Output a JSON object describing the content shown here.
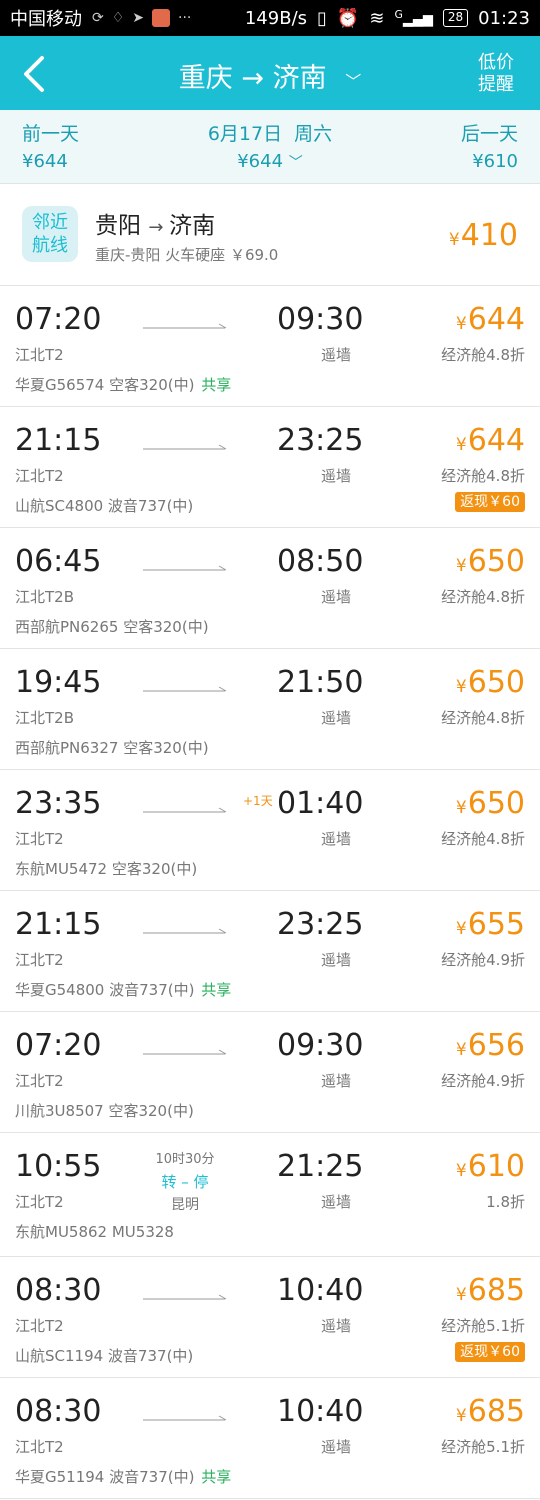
{
  "status_bar": {
    "carrier": "中国移动",
    "speed": "149B/s",
    "network": "G",
    "battery": "28",
    "time": "01:23"
  },
  "header": {
    "from": "重庆",
    "to": "济南",
    "alert_label_line1": "低价",
    "alert_label_line2": "提醒"
  },
  "date_bar": {
    "prev_label": "前一天",
    "prev_price": "¥644",
    "current_date": "6月17日",
    "current_weekday": "周六",
    "current_price": "¥644",
    "next_label": "后一天",
    "next_price": "¥610"
  },
  "nearby": {
    "badge_line1": "邻近",
    "badge_line2": "航线",
    "from": "贵阳",
    "to": "济南",
    "subtitle": "重庆-贵阳 火车硬座 ￥69.0",
    "price": "410",
    "currency": "¥"
  },
  "flights": [
    {
      "dep_time": "07:20",
      "arr_time": "09:30",
      "dep_term": "江北T2",
      "arr_term": "遥墙",
      "airline": "华夏G56574 空客320(中)",
      "tag": "共享",
      "price": "644",
      "cabin": "经济舱4.8折",
      "cashback": "",
      "plus_day": ""
    },
    {
      "dep_time": "21:15",
      "arr_time": "23:25",
      "dep_term": "江北T2",
      "arr_term": "遥墙",
      "airline": "山航SC4800 波音737(中)",
      "tag": "",
      "price": "644",
      "cabin": "经济舱4.8折",
      "cashback": "返现￥60",
      "plus_day": ""
    },
    {
      "dep_time": "06:45",
      "arr_time": "08:50",
      "dep_term": "江北T2B",
      "arr_term": "遥墙",
      "airline": "西部航PN6265 空客320(中)",
      "tag": "",
      "price": "650",
      "cabin": "经济舱4.8折",
      "cashback": "",
      "plus_day": ""
    },
    {
      "dep_time": "19:45",
      "arr_time": "21:50",
      "dep_term": "江北T2B",
      "arr_term": "遥墙",
      "airline": "西部航PN6327 空客320(中)",
      "tag": "",
      "price": "650",
      "cabin": "经济舱4.8折",
      "cashback": "",
      "plus_day": ""
    },
    {
      "dep_time": "23:35",
      "arr_time": "01:40",
      "dep_term": "江北T2",
      "arr_term": "遥墙",
      "airline": "东航MU5472 空客320(中)",
      "tag": "",
      "price": "650",
      "cabin": "经济舱4.8折",
      "cashback": "",
      "plus_day": "+1天"
    },
    {
      "dep_time": "21:15",
      "arr_time": "23:25",
      "dep_term": "江北T2",
      "arr_term": "遥墙",
      "airline": "华夏G54800 波音737(中)",
      "tag": "共享",
      "price": "655",
      "cabin": "经济舱4.9折",
      "cashback": "",
      "plus_day": ""
    },
    {
      "dep_time": "07:20",
      "arr_time": "09:30",
      "dep_term": "江北T2",
      "arr_term": "遥墙",
      "airline": "川航3U8507 空客320(中)",
      "tag": "",
      "price": "656",
      "cabin": "经济舱4.9折",
      "cashback": "",
      "plus_day": ""
    },
    {
      "dep_time": "10:55",
      "arr_time": "21:25",
      "dep_term": "江北T2",
      "arr_term": "遥墙",
      "airline": "东航MU5862 MU5328",
      "tag": "",
      "price": "610",
      "cabin": "1.8折",
      "cashback": "",
      "plus_day": "",
      "transfer": {
        "duration": "10时30分",
        "label": "转 – 停",
        "city": "昆明"
      }
    },
    {
      "dep_time": "08:30",
      "arr_time": "10:40",
      "dep_term": "江北T2",
      "arr_term": "遥墙",
      "airline": "山航SC1194 波音737(中)",
      "tag": "",
      "price": "685",
      "cabin": "经济舱5.1折",
      "cashback": "返现￥60",
      "plus_day": ""
    },
    {
      "dep_time": "08:30",
      "arr_time": "10:40",
      "dep_term": "江北T2",
      "arr_term": "遥墙",
      "airline": "华夏G51194 波音737(中)",
      "tag": "共享",
      "price": "685",
      "cabin": "经济舱5.1折",
      "cashback": "",
      "plus_day": ""
    }
  ]
}
